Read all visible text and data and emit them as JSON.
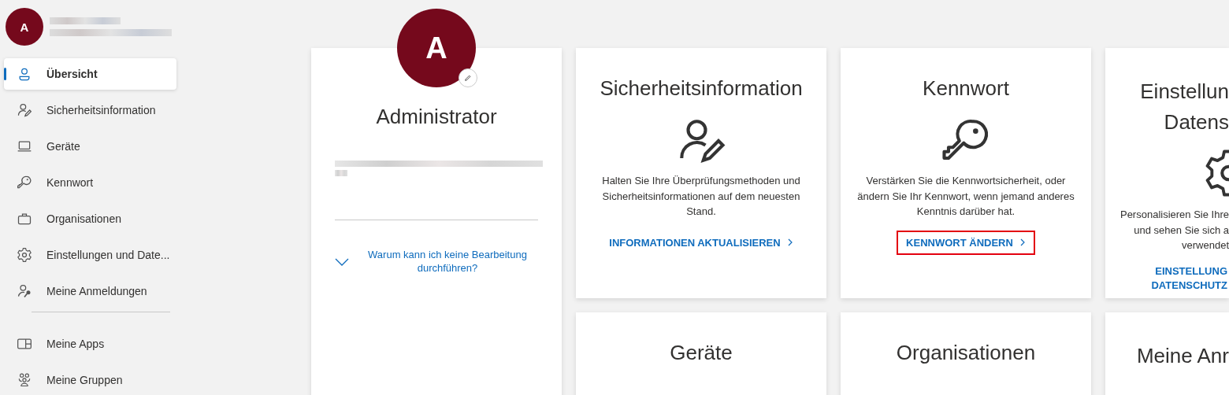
{
  "user": {
    "initial": "A"
  },
  "nav_sections": [
    {
      "items": [
        {
          "label": "Übersicht",
          "selected": true
        },
        {
          "label": "Sicherheitsinformation",
          "selected": false
        },
        {
          "label": "Geräte",
          "selected": false
        },
        {
          "label": "Kennwort",
          "selected": false
        },
        {
          "label": "Organisationen",
          "selected": false
        },
        {
          "label": "Einstellungen und Date...",
          "selected": false
        },
        {
          "label": "Meine Anmeldungen",
          "selected": false
        }
      ]
    },
    {
      "items": [
        {
          "label": "Meine Apps",
          "selected": false
        },
        {
          "label": "Meine Gruppen",
          "selected": false
        }
      ]
    }
  ],
  "profile": {
    "initial": "A",
    "name": "Administrator",
    "help_link": "Warum kann ich keine Bearbeitung durchführen?"
  },
  "cards": [
    {
      "kind": "full",
      "title": "Sicherheitsinformation",
      "description": "Halten Sie Ihre Überprüfungsmethoden und Sicherheitsinformationen auf dem neuesten Stand.",
      "action": "INFORMATIONEN AKTUALISIEREN",
      "highlighted": false
    },
    {
      "kind": "full",
      "title": "Kennwort",
      "description": "Verstärken Sie die Kennwortsicherheit, oder ändern Sie Ihr Kennwort, wenn jemand anderes Kenntnis darüber hat.",
      "action": "KENNWORT ÄNDERN",
      "highlighted": true
    },
    {
      "kind": "cut",
      "title_lines": [
        "Einstellun",
        "Datens"
      ],
      "description_lines": [
        "Personalisieren Sie Ihre",
        "und sehen Sie sich a",
        "verwendet"
      ],
      "action_lines": [
        "EINSTELLUNG",
        "DATENSCHUTZ"
      ]
    },
    {
      "kind": "full",
      "title": "Geräte"
    },
    {
      "kind": "full",
      "title": "Organisationen"
    },
    {
      "kind": "cut",
      "title_lines": [
        "Meine Anr"
      ]
    }
  ]
}
